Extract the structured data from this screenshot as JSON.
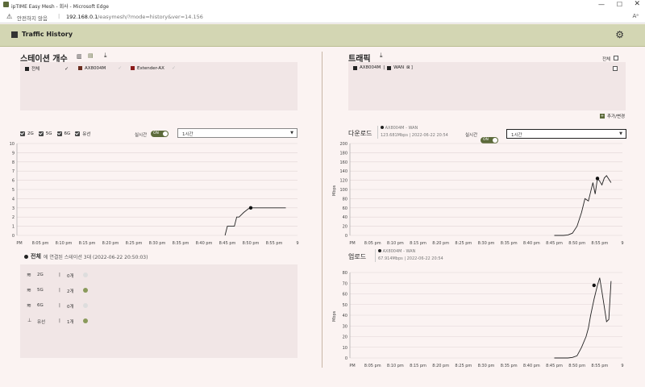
{
  "window": {
    "title": "ipTIME Easy Mesh - 회사 - Microsoft Edge"
  },
  "address": {
    "security": "안전하지 않음",
    "url_host": "192.168.0.1",
    "url_path": "/easymesh/?mode=history&ver=14.156"
  },
  "header": {
    "title": "Traffic History"
  },
  "left": {
    "section_title": "스테이션 개수",
    "legend": [
      {
        "label": "전체",
        "color": "#222222"
      },
      {
        "label": "AX8004M",
        "color": "#6b2d1f"
      },
      {
        "label": "Extender-AX",
        "color": "#8b1a1a"
      }
    ],
    "filters": [
      {
        "label": "2G"
      },
      {
        "label": "5G"
      },
      {
        "label": "6G"
      },
      {
        "label": "유선"
      }
    ],
    "realtime_label": "실시간",
    "toggle_label": "ON",
    "range_select": "1시간",
    "summary": {
      "name": "전체",
      "text": "에 연결된 스테이션 3대 (2022-06-22 20:50:03)"
    },
    "bands": [
      {
        "label": "2G",
        "count": "0개"
      },
      {
        "label": "5G",
        "count": "2개"
      },
      {
        "label": "6G",
        "count": "0개"
      },
      {
        "label": "유선",
        "count": "1개"
      }
    ]
  },
  "right": {
    "section_title": "트래픽",
    "all_label": "전체",
    "legend": [
      {
        "label": "AX8004M",
        "color": "#222222"
      },
      {
        "label": "WAN",
        "color": "#222222"
      }
    ],
    "add_button": "추가/변경",
    "download": {
      "label": "다운로드",
      "tooltip_name": "AX8004M - WAN",
      "tooltip_value": "123.681Mbps | 2022-06-22 20:54"
    },
    "upload": {
      "label": "업로드",
      "tooltip_name": "AX8004M - WAN",
      "tooltip_value": "67.914Mbps | 2022-06-22 20:54"
    },
    "realtime_label": "실시간",
    "toggle_label": "ON",
    "range_select": "1시간"
  },
  "chart_data": [
    {
      "type": "line",
      "title": "스테이션 개수",
      "x_ticks": [
        "PM",
        "8:05 pm",
        "8:10 pm",
        "8:15 pm",
        "8:20 pm",
        "8:25 pm",
        "8:30 pm",
        "8:35 pm",
        "8:40 pm",
        "8:45 pm",
        "8:50 pm",
        "8:55 pm",
        "9"
      ],
      "ylim": [
        0,
        10
      ],
      "y_ticks": [
        0,
        1,
        2,
        3,
        4,
        5,
        6,
        7,
        8,
        9,
        10
      ],
      "series": [
        {
          "values_x": [
            8.9,
            9.0,
            9.3,
            9.4,
            9.5,
            9.7,
            9.9,
            10.0,
            11.5
          ],
          "values_y": [
            0,
            1,
            1,
            2,
            2,
            2.5,
            2.9,
            3,
            3
          ]
        }
      ],
      "highlight": {
        "x": 10.0,
        "y": 3
      }
    },
    {
      "type": "line",
      "title": "다운로드",
      "ylabel": "Mbps",
      "x_ticks": [
        "PM",
        "8:05 pm",
        "8:10 pm",
        "8:15 pm",
        "8:20 pm",
        "8:25 pm",
        "8:30 pm",
        "8:35 pm",
        "8:40 pm",
        "8:45 pm",
        "8:50 pm",
        "8:55 pm",
        "9"
      ],
      "ylim": [
        0,
        200
      ],
      "y_ticks": [
        0,
        20,
        40,
        60,
        80,
        100,
        120,
        140,
        160,
        180,
        200
      ],
      "series": [
        {
          "values_x": [
            9.0,
            9.4,
            9.6,
            9.8,
            10.0,
            10.2,
            10.35,
            10.5,
            10.6,
            10.7,
            10.8,
            10.9,
            11.0,
            11.1,
            11.2,
            11.3,
            11.5
          ],
          "values_y": [
            0,
            0,
            1,
            5,
            20,
            50,
            80,
            75,
            95,
            115,
            90,
            124,
            118,
            110,
            125,
            130,
            115
          ]
        }
      ],
      "highlight": {
        "x": 10.9,
        "y": 124
      }
    },
    {
      "type": "line",
      "title": "업로드",
      "ylabel": "Mbps",
      "x_ticks": [
        "PM",
        "8:05 pm",
        "8:10 pm",
        "8:15 pm",
        "8:20 pm",
        "8:25 pm",
        "8:30 pm",
        "8:35 pm",
        "8:40 pm",
        "8:45 pm",
        "8:50 pm",
        "8:55 pm",
        "9"
      ],
      "ylim": [
        0,
        80
      ],
      "y_ticks": [
        0,
        10,
        20,
        30,
        40,
        50,
        60,
        70,
        80
      ],
      "series": [
        {
          "values_x": [
            9.0,
            9.6,
            9.8,
            10.0,
            10.2,
            10.4,
            10.5,
            10.6,
            10.75,
            10.9,
            11.0,
            11.1,
            11.2,
            11.3,
            11.4,
            11.5
          ],
          "values_y": [
            0,
            0,
            0.5,
            2,
            10,
            20,
            28,
            40,
            55,
            68,
            75,
            62,
            48,
            34,
            36,
            72
          ]
        }
      ],
      "highlight": {
        "x": 10.75,
        "y": 68
      }
    }
  ]
}
